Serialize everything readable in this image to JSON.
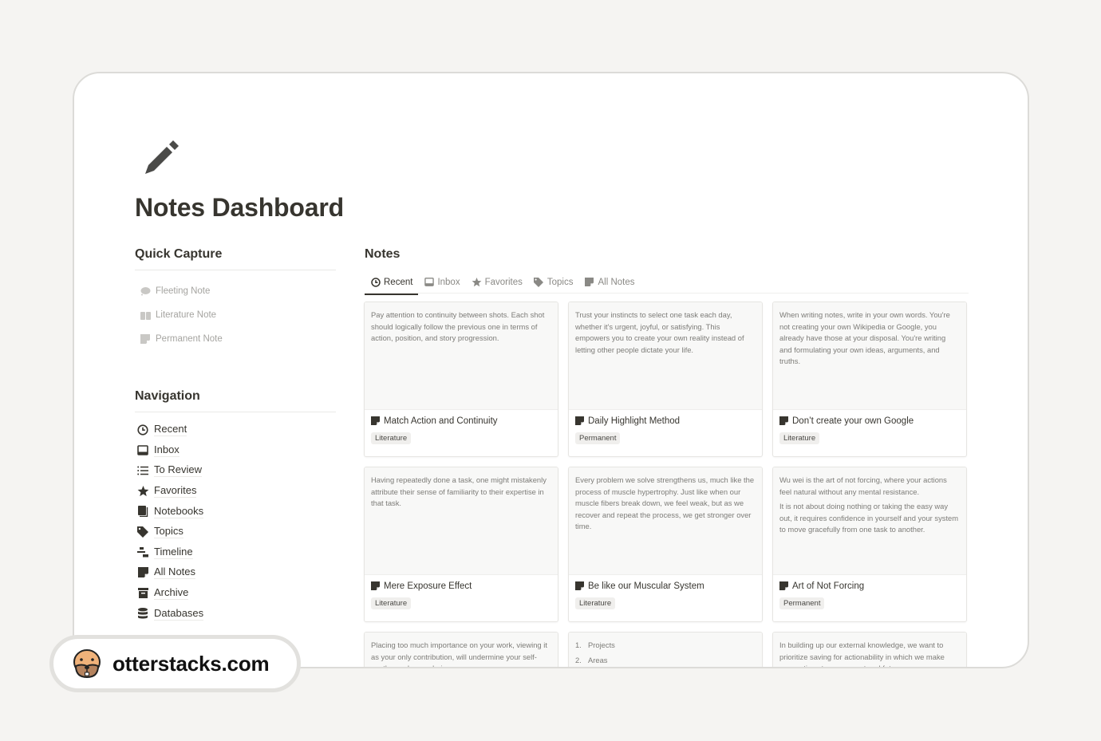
{
  "page": {
    "icon": "pencil-icon",
    "title": "Notes Dashboard"
  },
  "quick_capture": {
    "heading": "Quick Capture",
    "items": [
      {
        "label": "Fleeting Note",
        "icon": "cloud-icon"
      },
      {
        "label": "Literature Note",
        "icon": "book-icon"
      },
      {
        "label": "Permanent Note",
        "icon": "sticky-note-icon"
      }
    ]
  },
  "navigation": {
    "heading": "Navigation",
    "items": [
      {
        "label": "Recent",
        "icon": "clock-icon"
      },
      {
        "label": "Inbox",
        "icon": "inbox-icon"
      },
      {
        "label": "To Review",
        "icon": "list-icon"
      },
      {
        "label": "Favorites",
        "icon": "star-icon"
      },
      {
        "label": "Notebooks",
        "icon": "notebooks-icon"
      },
      {
        "label": "Topics",
        "icon": "tag-icon"
      },
      {
        "label": "Timeline",
        "icon": "timeline-icon"
      },
      {
        "label": "All Notes",
        "icon": "sticky-note-icon"
      },
      {
        "label": "Archive",
        "icon": "archive-icon"
      },
      {
        "label": "Databases",
        "icon": "database-icon"
      }
    ]
  },
  "notes": {
    "heading": "Notes",
    "tabs": [
      {
        "label": "Recent",
        "icon": "clock-icon",
        "active": true
      },
      {
        "label": "Inbox",
        "icon": "inbox-icon",
        "active": false
      },
      {
        "label": "Favorites",
        "icon": "star-icon",
        "active": false
      },
      {
        "label": "Topics",
        "icon": "tag-icon",
        "active": false
      },
      {
        "label": "All Notes",
        "icon": "sticky-note-icon",
        "active": false
      }
    ],
    "cards": [
      {
        "preview": [
          "Pay attention to continuity between shots. Each shot should logically follow the previous one in terms of action, position, and story progression."
        ],
        "title": "Match Action and Continuity",
        "tag": "Literature"
      },
      {
        "preview": [
          "Trust your instincts to select one task each day, whether it's urgent, joyful, or satisfying. This empowers you to create your own reality instead of letting other people dictate your life."
        ],
        "title": "Daily Highlight Method",
        "tag": "Permanent"
      },
      {
        "preview": [
          "When writing notes, write in your own words. You're not creating your own Wikipedia or Google, you already have those at your disposal. You're writing and formulating your own ideas, arguments, and truths."
        ],
        "title": "Don’t create your own Google",
        "tag": "Literature"
      },
      {
        "preview": [
          "Having repeatedly done a task, one might mistakenly attribute their sense of familiarity to their expertise in that task."
        ],
        "title": "Mere Exposure Effect",
        "tag": "Literature"
      },
      {
        "preview": [
          "Every problem we solve strengthens us, much like the process of muscle hypertrophy. Just like when our muscle fibers break down, we feel weak, but as we recover and repeat the process, we get stronger over time."
        ],
        "title": "Be like our Muscular System",
        "tag": "Literature"
      },
      {
        "preview": [
          "Wu wei is the art of not forcing, where your actions feel natural without any mental resistance.",
          "It is not about doing nothing or taking the easy way out, it requires confidence in yourself and your system to move gracefully from one task to another."
        ],
        "title": "Art of Not Forcing",
        "tag": "Permanent"
      }
    ],
    "partial_cards": [
      {
        "preview": "Placing too much importance on your work, viewing it as your only contribution, will undermine your self-worth as a human being."
      },
      {
        "list": [
          "Projects",
          "Areas"
        ]
      },
      {
        "preview": "In building up our external knowledge, we want to prioritize saving for actionability in which we make connections to our current and future"
      }
    ]
  },
  "badge": {
    "icon": "otter-logo-icon",
    "site": "otterstacks.com"
  }
}
